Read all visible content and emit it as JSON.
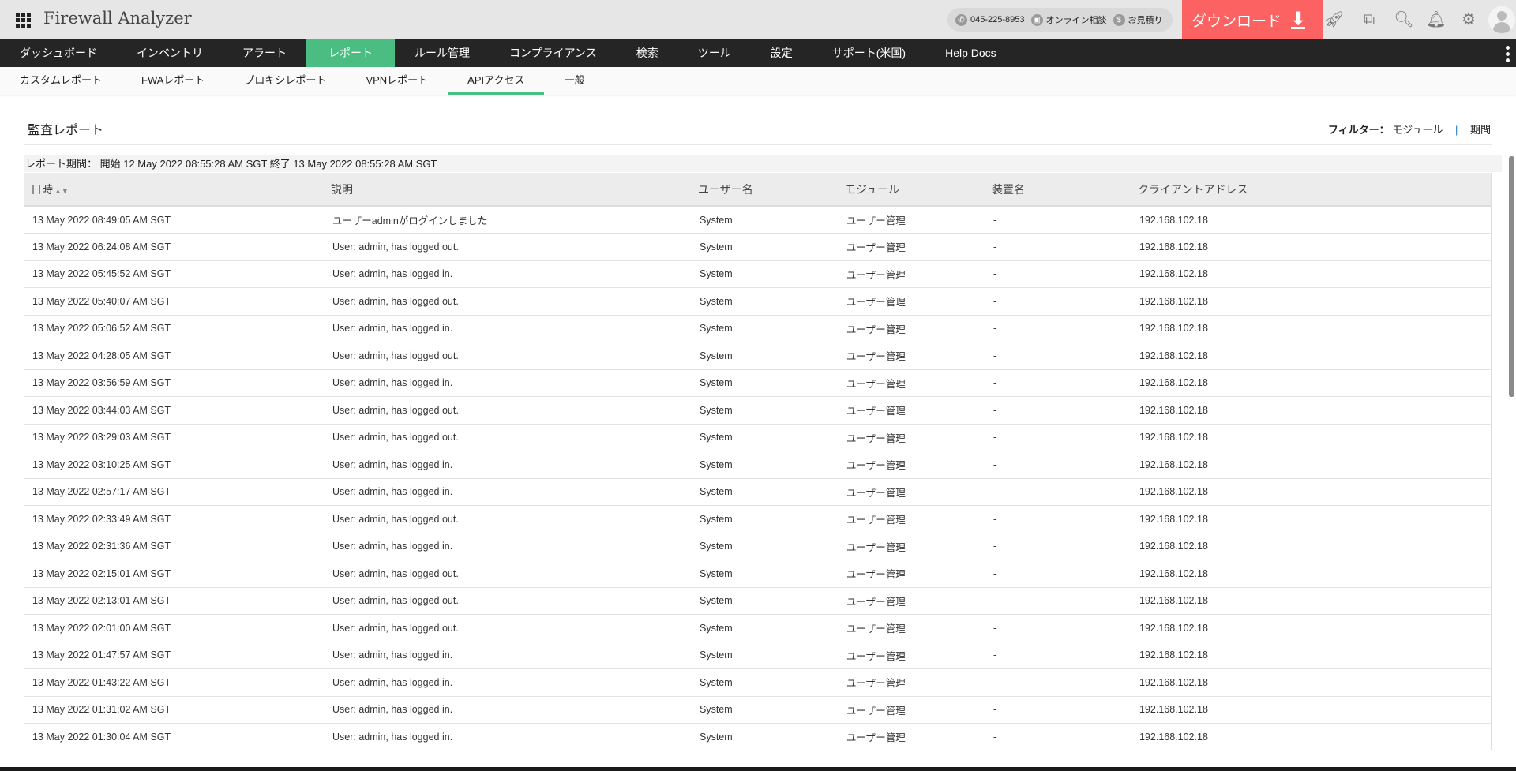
{
  "header": {
    "app_title": "Firewall Analyzer",
    "phone": "045-225-8953",
    "online": "オンライン相談",
    "quote": "お見積り",
    "download": "ダウンロード"
  },
  "nav": [
    "ダッシュボード",
    "インベントリ",
    "アラート",
    "レポート",
    "ルール管理",
    "コンプライアンス",
    "検索",
    "ツール",
    "設定",
    "サポート(米国)",
    "Help Docs"
  ],
  "subnav": [
    "カスタムレポート",
    "FWAレポート",
    "プロキシレポート",
    "VPNレポート",
    "APIアクセス",
    "一般"
  ],
  "page": {
    "title": "監査レポート",
    "filter_label": "フィルター：",
    "filter_module": "モジュール",
    "filter_sep": "|",
    "filter_period": "期間",
    "period": "レポート期間： 開始 12 May 2022 08:55:28 AM SGT 終了 13 May 2022 08:55:28 AM SGT"
  },
  "table": {
    "headers": [
      "日時",
      "説明",
      "ユーザー名",
      "モジュール",
      "装置名",
      "クライアントアドレス"
    ],
    "rows": [
      [
        "13 May 2022 08:49:05 AM SGT",
        "ユーザーadminがログインしました",
        "System",
        "ユーザー管理",
        "-",
        "192.168.102.18"
      ],
      [
        "13 May 2022 06:24:08 AM SGT",
        "User: admin, has logged out.",
        "System",
        "ユーザー管理",
        "-",
        "192.168.102.18"
      ],
      [
        "13 May 2022 05:45:52 AM SGT",
        "User: admin, has logged in.",
        "System",
        "ユーザー管理",
        "-",
        "192.168.102.18"
      ],
      [
        "13 May 2022 05:40:07 AM SGT",
        "User: admin, has logged out.",
        "System",
        "ユーザー管理",
        "-",
        "192.168.102.18"
      ],
      [
        "13 May 2022 05:06:52 AM SGT",
        "User: admin, has logged in.",
        "System",
        "ユーザー管理",
        "-",
        "192.168.102.18"
      ],
      [
        "13 May 2022 04:28:05 AM SGT",
        "User: admin, has logged out.",
        "System",
        "ユーザー管理",
        "-",
        "192.168.102.18"
      ],
      [
        "13 May 2022 03:56:59 AM SGT",
        "User: admin, has logged in.",
        "System",
        "ユーザー管理",
        "-",
        "192.168.102.18"
      ],
      [
        "13 May 2022 03:44:03 AM SGT",
        "User: admin, has logged out.",
        "System",
        "ユーザー管理",
        "-",
        "192.168.102.18"
      ],
      [
        "13 May 2022 03:29:03 AM SGT",
        "User: admin, has logged out.",
        "System",
        "ユーザー管理",
        "-",
        "192.168.102.18"
      ],
      [
        "13 May 2022 03:10:25 AM SGT",
        "User: admin, has logged in.",
        "System",
        "ユーザー管理",
        "-",
        "192.168.102.18"
      ],
      [
        "13 May 2022 02:57:17 AM SGT",
        "User: admin, has logged in.",
        "System",
        "ユーザー管理",
        "-",
        "192.168.102.18"
      ],
      [
        "13 May 2022 02:33:49 AM SGT",
        "User: admin, has logged out.",
        "System",
        "ユーザー管理",
        "-",
        "192.168.102.18"
      ],
      [
        "13 May 2022 02:31:36 AM SGT",
        "User: admin, has logged in.",
        "System",
        "ユーザー管理",
        "-",
        "192.168.102.18"
      ],
      [
        "13 May 2022 02:15:01 AM SGT",
        "User: admin, has logged out.",
        "System",
        "ユーザー管理",
        "-",
        "192.168.102.18"
      ],
      [
        "13 May 2022 02:13:01 AM SGT",
        "User: admin, has logged out.",
        "System",
        "ユーザー管理",
        "-",
        "192.168.102.18"
      ],
      [
        "13 May 2022 02:01:00 AM SGT",
        "User: admin, has logged out.",
        "System",
        "ユーザー管理",
        "-",
        "192.168.102.18"
      ],
      [
        "13 May 2022 01:47:57 AM SGT",
        "User: admin, has logged in.",
        "System",
        "ユーザー管理",
        "-",
        "192.168.102.18"
      ],
      [
        "13 May 2022 01:43:22 AM SGT",
        "User: admin, has logged in.",
        "System",
        "ユーザー管理",
        "-",
        "192.168.102.18"
      ],
      [
        "13 May 2022 01:31:02 AM SGT",
        "User: admin, has logged in.",
        "System",
        "ユーザー管理",
        "-",
        "192.168.102.18"
      ],
      [
        "13 May 2022 01:30:04 AM SGT",
        "User: admin, has logged in.",
        "System",
        "ユーザー管理",
        "-",
        "192.168.102.18"
      ]
    ]
  },
  "colors": {
    "accent": "#4cbd82",
    "download": "#fc6262",
    "nav_bg": "#252525"
  }
}
